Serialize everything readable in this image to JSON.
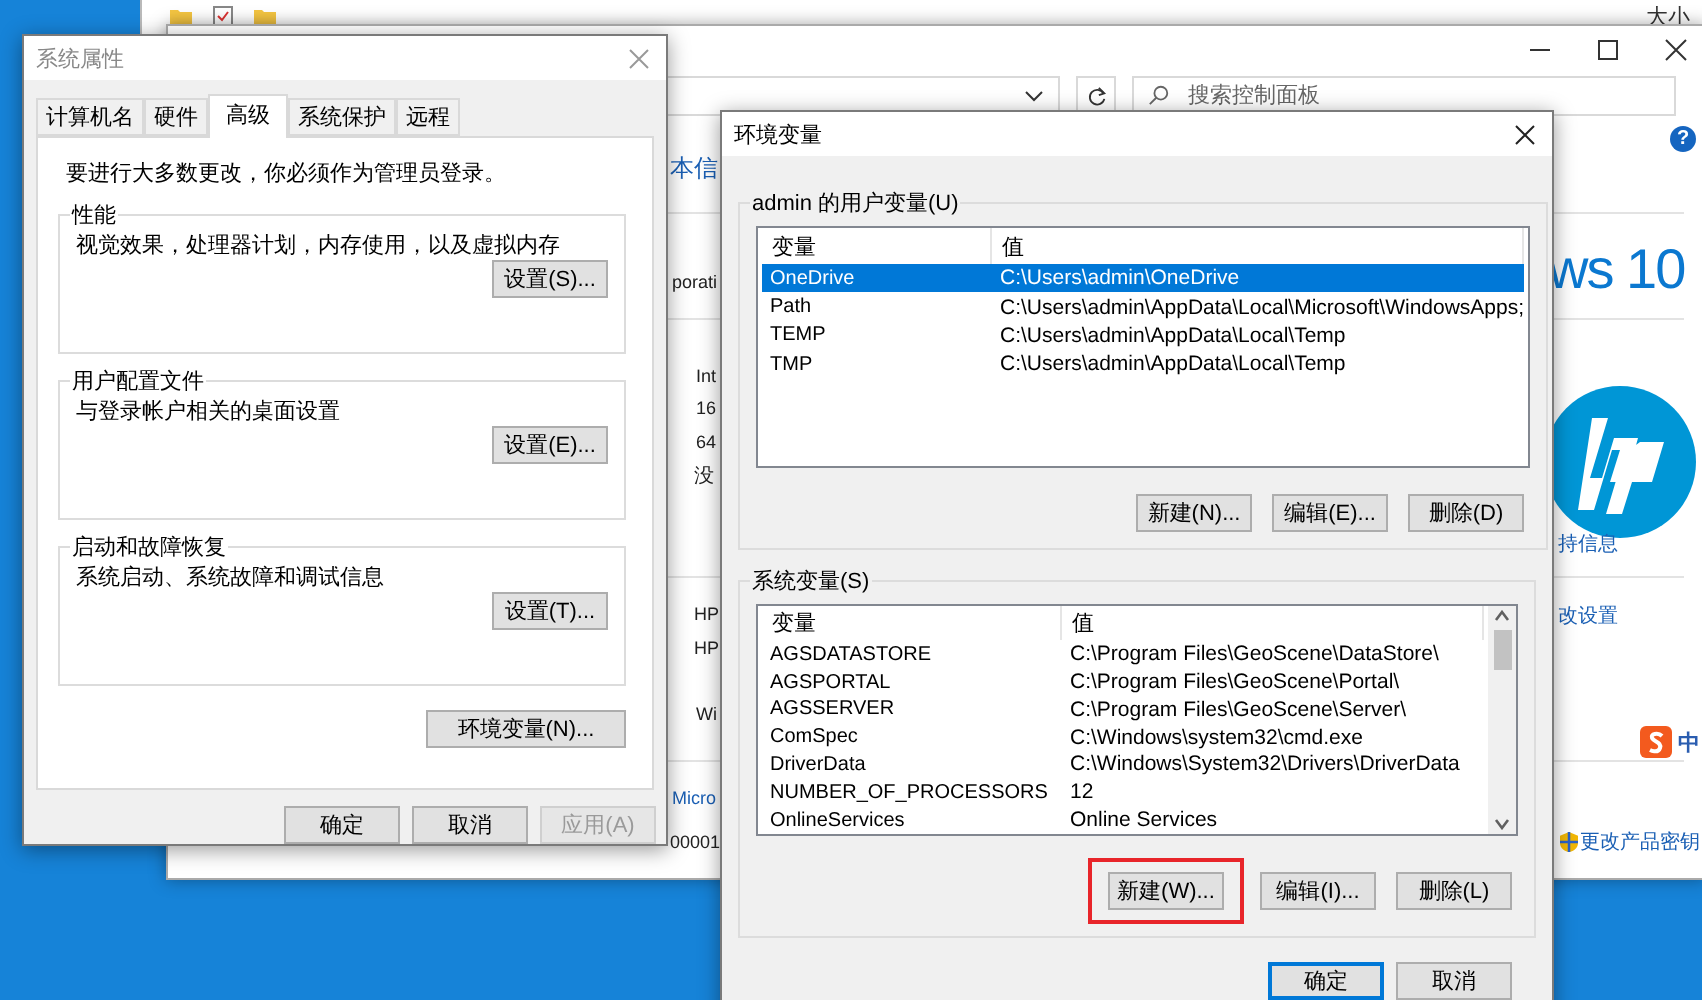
{
  "background_window": {
    "column_header": "大小"
  },
  "control_panel": {
    "search": {
      "placeholder": "搜索控制面板"
    },
    "help_glyph": "?",
    "left_fragments": [
      {
        "text": "本信",
        "kind": "heading"
      },
      {
        "text": "porati",
        "kind": "text"
      },
      {
        "text": "Int",
        "kind": "text"
      },
      {
        "text": "16",
        "kind": "text"
      },
      {
        "text": "64",
        "kind": "text"
      },
      {
        "text": "没",
        "kind": "text"
      },
      {
        "text": "HP",
        "kind": "text"
      },
      {
        "text": "HP",
        "kind": "text"
      },
      {
        "text": "Wi",
        "kind": "text"
      },
      {
        "text": "Micro",
        "kind": "link"
      },
      {
        "text": "00001",
        "kind": "text"
      }
    ],
    "logo_text": "ws 10",
    "right_links": [
      {
        "text": "持信息",
        "kind": "link"
      },
      {
        "text": "改设置",
        "kind": "link"
      },
      {
        "text": "更改产品密钥",
        "kind": "shield_link"
      }
    ]
  },
  "ime_bar": {
    "label": "中"
  },
  "system_properties": {
    "title": "系统属性",
    "tabs": [
      {
        "label": "计算机名",
        "selected": false
      },
      {
        "label": "硬件",
        "selected": false
      },
      {
        "label": "高级",
        "selected": true
      },
      {
        "label": "系统保护",
        "selected": false
      },
      {
        "label": "远程",
        "selected": false
      }
    ],
    "notice": "要进行大多数更改，你必须作为管理员登录。",
    "groups": [
      {
        "title": "性能",
        "description": "视觉效果，处理器计划，内存使用，以及虚拟内存",
        "button": "设置(S)..."
      },
      {
        "title": "用户配置文件",
        "description": "与登录帐户相关的桌面设置",
        "button": "设置(E)..."
      },
      {
        "title": "启动和故障恢复",
        "description": "系统启动、系统故障和调试信息",
        "button": "设置(T)..."
      }
    ],
    "env_button": "环境变量(N)...",
    "buttons": [
      {
        "label": "确定",
        "disabled": false
      },
      {
        "label": "取消",
        "disabled": false
      },
      {
        "label": "应用(A)",
        "disabled": true
      }
    ]
  },
  "environment_variables": {
    "title": "环境变量",
    "user_variables": {
      "label": "admin 的用户变量(U)",
      "columns": [
        "变量",
        "值"
      ],
      "rows": [
        {
          "name": "OneDrive",
          "value": "C:\\Users\\admin\\OneDrive",
          "selected": true
        },
        {
          "name": "Path",
          "value": "C:\\Users\\admin\\AppData\\Local\\Microsoft\\WindowsApps;",
          "selected": false
        },
        {
          "name": "TEMP",
          "value": "C:\\Users\\admin\\AppData\\Local\\Temp",
          "selected": false
        },
        {
          "name": "TMP",
          "value": "C:\\Users\\admin\\AppData\\Local\\Temp",
          "selected": false
        }
      ],
      "buttons": [
        {
          "label": "新建(N)...",
          "highlighted": false
        },
        {
          "label": "编辑(E)...",
          "highlighted": false
        },
        {
          "label": "删除(D)",
          "highlighted": false
        }
      ]
    },
    "system_variables": {
      "label": "系统变量(S)",
      "columns": [
        "变量",
        "值"
      ],
      "rows": [
        {
          "name": "AGSDATASTORE",
          "value": "C:\\Program Files\\GeoScene\\DataStore\\",
          "selected": false
        },
        {
          "name": "AGSPORTAL",
          "value": "C:\\Program Files\\GeoScene\\Portal\\",
          "selected": false
        },
        {
          "name": "AGSSERVER",
          "value": "C:\\Program Files\\GeoScene\\Server\\",
          "selected": false
        },
        {
          "name": "ComSpec",
          "value": "C:\\Windows\\system32\\cmd.exe",
          "selected": false
        },
        {
          "name": "DriverData",
          "value": "C:\\Windows\\System32\\Drivers\\DriverData",
          "selected": false
        },
        {
          "name": "NUMBER_OF_PROCESSORS",
          "value": "12",
          "selected": false
        },
        {
          "name": "OnlineServices",
          "value": "Online Services",
          "selected": false
        }
      ],
      "buttons": [
        {
          "label": "新建(W)...",
          "highlighted": true
        },
        {
          "label": "编辑(I)...",
          "highlighted": false
        },
        {
          "label": "删除(L)",
          "highlighted": false
        }
      ]
    },
    "buttons": [
      {
        "label": "确定",
        "default": true
      },
      {
        "label": "取消",
        "default": false
      }
    ]
  }
}
